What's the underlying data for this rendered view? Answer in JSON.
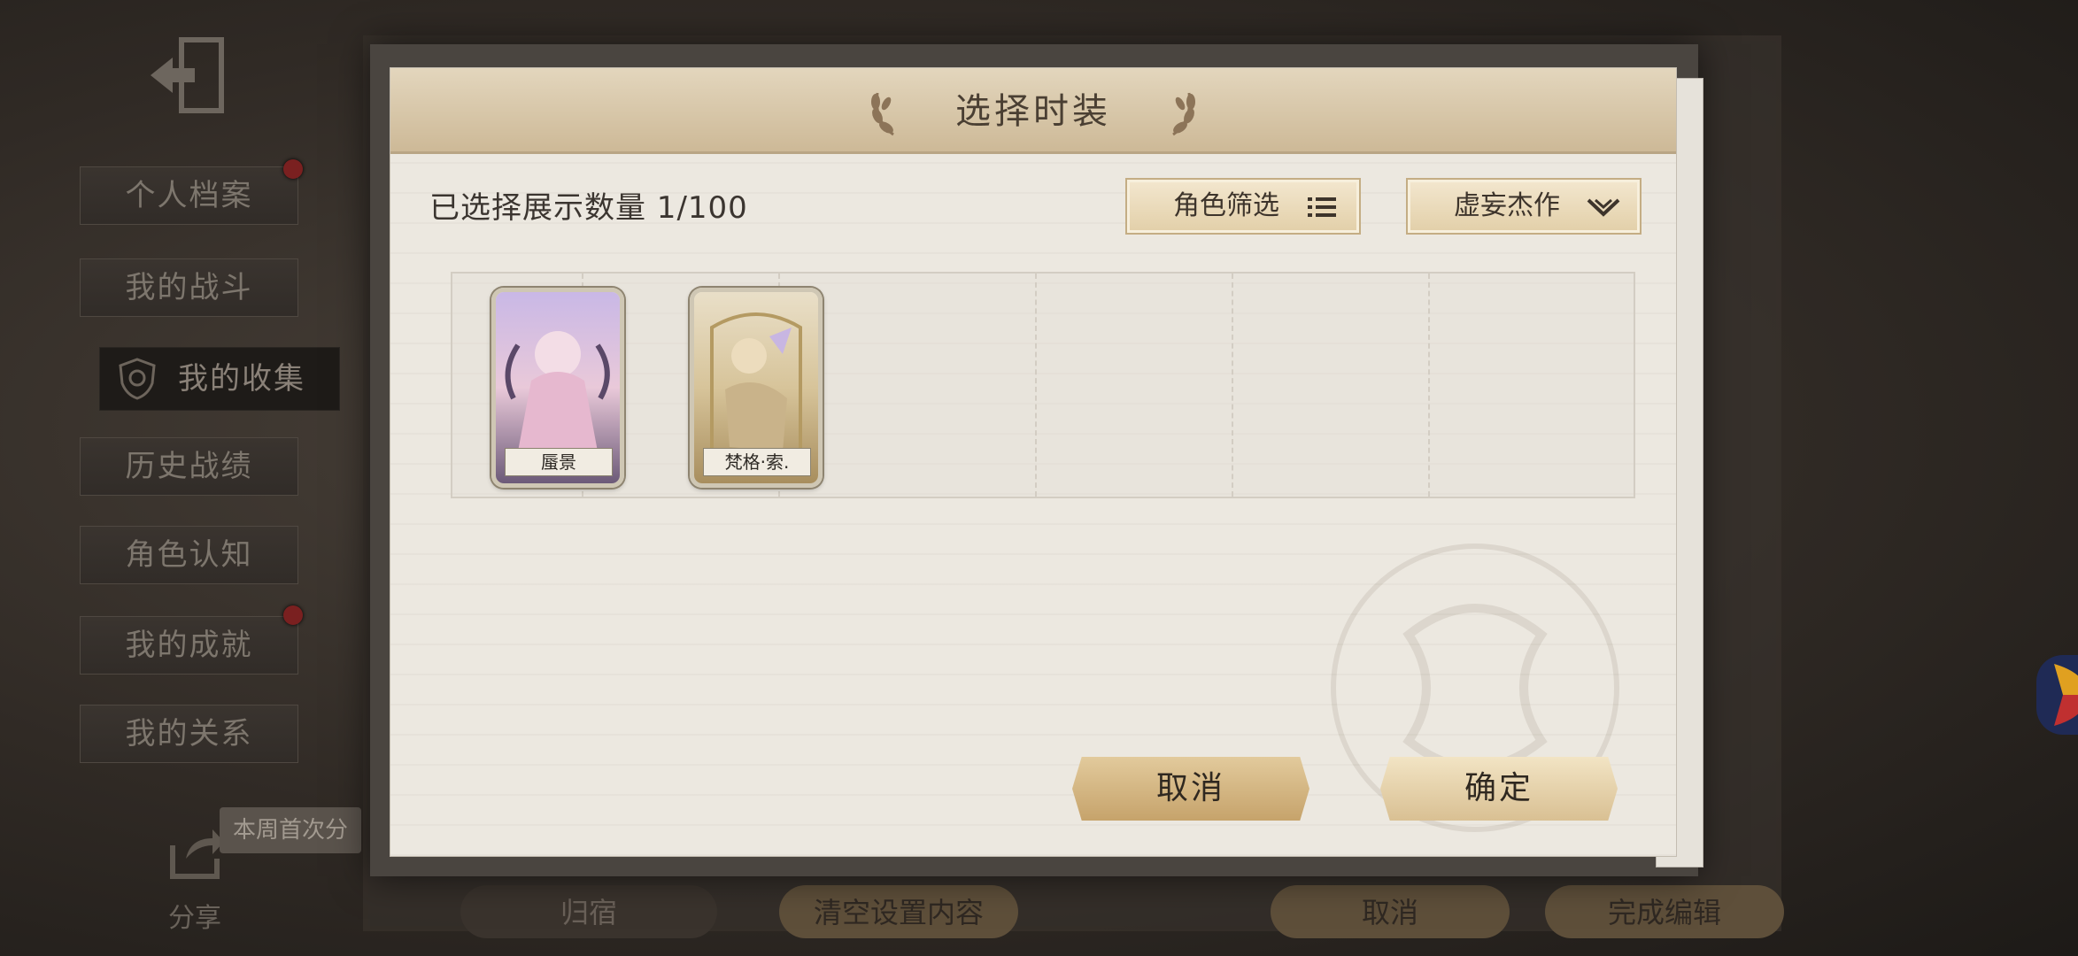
{
  "dialog": {
    "title": "选择时装",
    "selected_count_label": "已选择展示数量 1/100",
    "role_filter_label": "角色筛选",
    "collection_dropdown_value": "虚妄杰作",
    "cancel_label": "取消",
    "confirm_label": "确定",
    "cards": [
      {
        "name": "蜃景"
      },
      {
        "name": "梵格·索."
      }
    ]
  },
  "background": {
    "sidebar": [
      {
        "label": "个人档案"
      },
      {
        "label": "我的战斗"
      },
      {
        "label": "我的收集"
      },
      {
        "label": "历史战绩"
      },
      {
        "label": "角色认知"
      },
      {
        "label": "我的成就"
      },
      {
        "label": "我的关系"
      }
    ],
    "share_tip": "本周首次分",
    "share_label": "分享",
    "bottom_buttons": [
      {
        "label": "归宿"
      },
      {
        "label": "清空设置内容"
      },
      {
        "label": "取消"
      },
      {
        "label": "完成编辑"
      }
    ]
  },
  "colors": {
    "accent_gold": "#d9c093",
    "dialog_paper": "#ece8e0",
    "notification_dot": "#7a2020"
  },
  "icons": [
    "exit-icon",
    "shield-icon",
    "laurel-icon",
    "list-icon",
    "chevron-down-icon",
    "share-icon"
  ]
}
